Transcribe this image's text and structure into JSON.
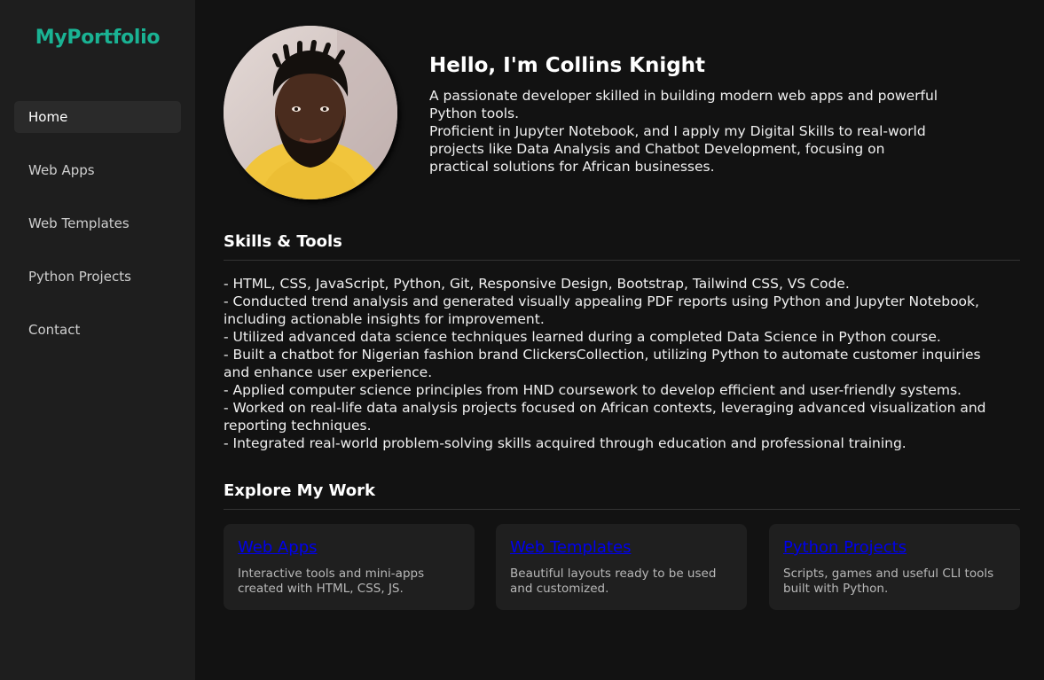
{
  "brand": "MyPortfolio",
  "nav": [
    {
      "label": "Home",
      "active": true
    },
    {
      "label": "Web Apps",
      "active": false
    },
    {
      "label": "Web Templates",
      "active": false
    },
    {
      "label": "Python Projects",
      "active": false
    },
    {
      "label": "Contact",
      "active": false
    }
  ],
  "hero": {
    "title": "Hello, I'm Collins Knight",
    "line1": "A passionate developer skilled in building modern web apps and powerful Python tools.",
    "line2": "Proficient in Jupyter Notebook, and I apply my Digital Skills to real-world projects like Data Analysis and Chatbot Development, focusing on practical solutions for African businesses."
  },
  "skills": {
    "title": "Skills & Tools",
    "items": [
      "- HTML, CSS, JavaScript, Python, Git, Responsive Design, Bootstrap, Tailwind CSS, VS Code.",
      "- Conducted trend analysis and generated visually appealing PDF reports using Python and Jupyter Notebook, including actionable insights for improvement.",
      "- Utilized advanced data science techniques learned during a completed Data Science in Python course.",
      "- Built a chatbot for Nigerian fashion brand ClickersCollection, utilizing Python to automate customer inquiries and enhance user experience.",
      "- Applied computer science principles from HND coursework to develop efficient and user-friendly systems.",
      "- Worked on real-life data analysis projects focused on African contexts, leveraging advanced visualization and reporting techniques.",
      "- Integrated real-world problem-solving skills acquired through education and professional training."
    ]
  },
  "explore": {
    "title": "Explore My Work",
    "cards": [
      {
        "title": "Web Apps",
        "desc": "Interactive tools and mini-apps created with HTML, CSS, JS."
      },
      {
        "title": "Web Templates",
        "desc": "Beautiful layouts ready to be used and customized."
      },
      {
        "title": "Python Projects",
        "desc": "Scripts, games and useful CLI tools built with Python."
      }
    ]
  },
  "colors": {
    "brand": "#1ab394",
    "link": "#0000ee",
    "sidebar_bg": "#1e1e1e",
    "main_bg": "#121212",
    "card_bg": "#1f1f1f"
  }
}
